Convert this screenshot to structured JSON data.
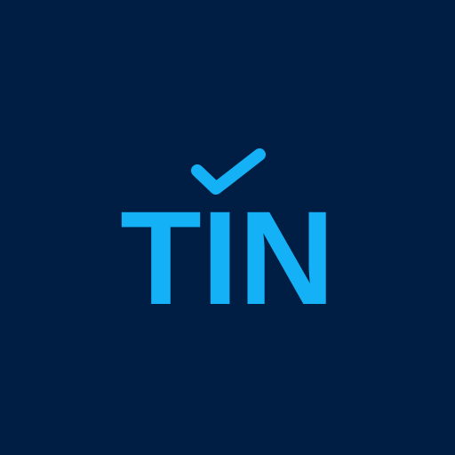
{
  "logo": {
    "text": "TIN",
    "icon": "check-icon",
    "colors": {
      "background": "#001d43",
      "accent": "#14b1f6"
    }
  }
}
